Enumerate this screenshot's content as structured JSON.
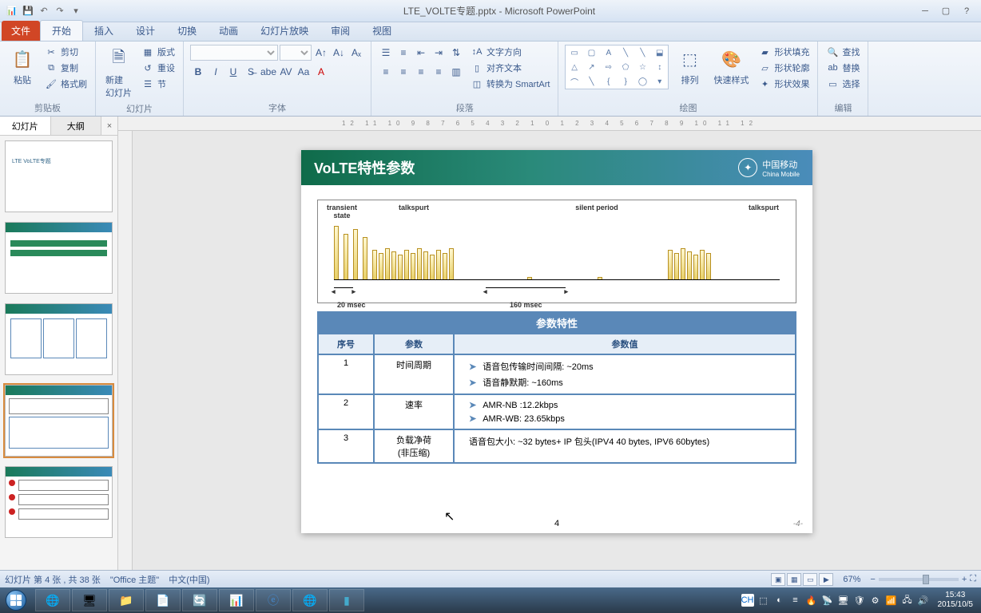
{
  "title": "LTE_VOLTE专题.pptx - Microsoft PowerPoint",
  "ribbon_tabs": {
    "file": "文件",
    "home": "开始",
    "insert": "插入",
    "design": "设计",
    "transitions": "切换",
    "animations": "动画",
    "slideshow": "幻灯片放映",
    "review": "审阅",
    "view": "视图"
  },
  "ribbon": {
    "clipboard": {
      "label": "剪贴板",
      "paste": "粘贴",
      "cut": "剪切",
      "copy": "复制",
      "format_painter": "格式刷"
    },
    "slides": {
      "label": "幻灯片",
      "new_slide": "新建\n幻灯片",
      "layout": "版式",
      "reset": "重设",
      "section": "节"
    },
    "font": {
      "label": "字体",
      "fontname": "",
      "fontsize": ""
    },
    "paragraph": {
      "label": "段落",
      "text_direction": "文字方向",
      "align_text": "对齐文本",
      "convert_smartart": "转换为 SmartArt"
    },
    "drawing": {
      "label": "绘图",
      "arrange": "排列",
      "quick_styles": "快速样式",
      "shape_fill": "形状填充",
      "shape_outline": "形状轮廓",
      "shape_effects": "形状效果"
    },
    "editing": {
      "label": "编辑",
      "find": "查找",
      "replace": "替换",
      "select": "选择"
    }
  },
  "panel_tabs": {
    "slides": "幻灯片",
    "outline": "大纲"
  },
  "ruler_text": "12 11 10 9 8 7 6 5 4 3 2 1 0 1 2 3 4 5 6 7 8 9 10 11 12",
  "slide": {
    "title": "VoLTE特性参数",
    "brand": "中国移动",
    "brand_en": "China Mobile",
    "diagram": {
      "transient": "transient\nstate",
      "talkspurt": "talkspurt",
      "silent": "silent period",
      "talkspurt2": "talkspurt",
      "interval_20": "20 msec",
      "interval_160": "160  msec"
    },
    "table": {
      "header": "参数特性",
      "cols": {
        "no": "序号",
        "param": "参数",
        "value": "参数值"
      },
      "rows": [
        {
          "no": "1",
          "param": "时间周期",
          "values": [
            "语音包传输时间间隔:   ~20ms",
            "语音静默期:  ~160ms"
          ]
        },
        {
          "no": "2",
          "param": "速率",
          "values": [
            "AMR-NB :12.2kbps",
            "AMR-WB: 23.65kbps"
          ]
        },
        {
          "no": "3",
          "param": "负载净荷\n(非压缩)",
          "values": [
            "语音包大小: ~32 bytes+ IP 包头(IPV4  40 bytes, IPV6 60bytes)"
          ]
        }
      ]
    },
    "page_num": "4",
    "page_num_r": "-4-"
  },
  "status": {
    "slide_info": "幻灯片 第 4 张 , 共 38 张",
    "theme": "\"Office 主题\"",
    "lang": "中文(中国)",
    "zoom": "67%"
  },
  "tray": {
    "ime": "CH",
    "time": "15:43",
    "date": "2015/10/5"
  }
}
